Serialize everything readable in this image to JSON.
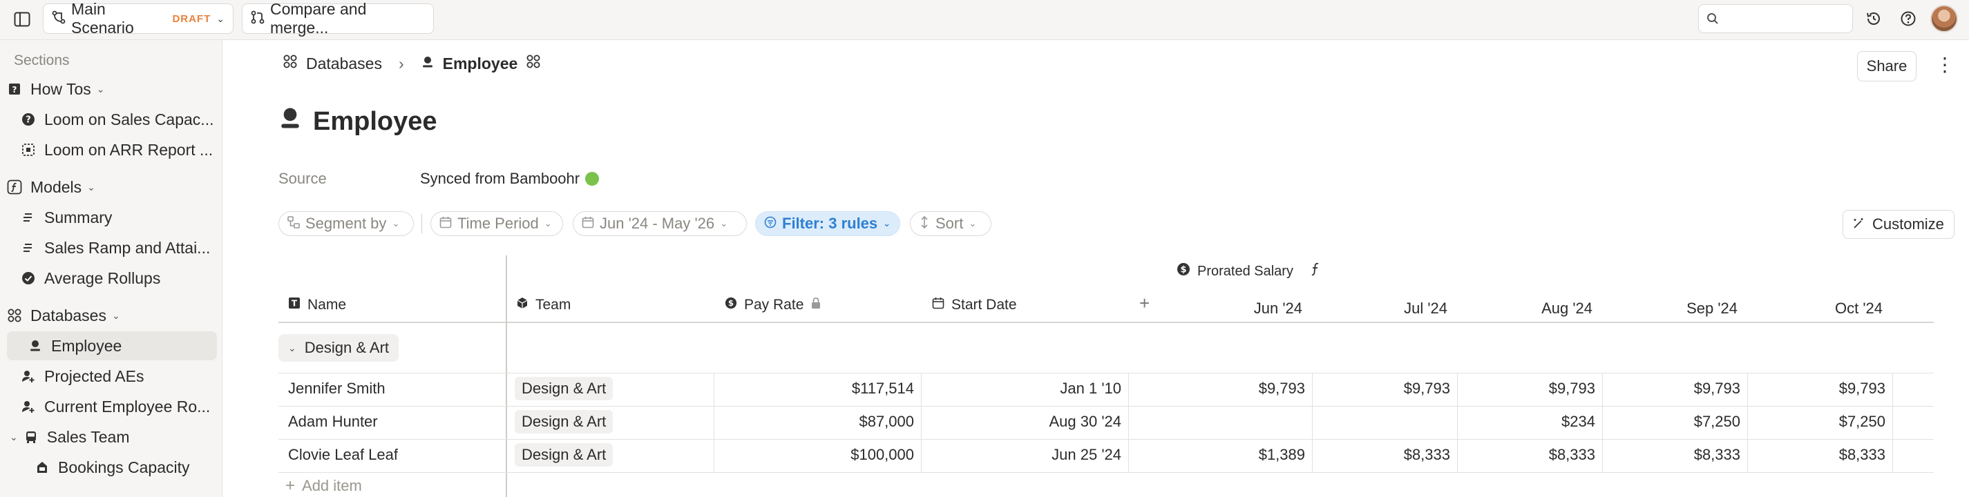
{
  "topbar": {
    "scenario_name": "Main Scenario",
    "scenario_badge": "DRAFT",
    "compare_label": "Compare and merge...",
    "search_placeholder": ""
  },
  "sidebar": {
    "section_label": "Sections",
    "how_tos": {
      "label": "How Tos",
      "items": [
        {
          "label": "Loom on Sales Capac..."
        },
        {
          "label": "Loom on ARR Report ..."
        }
      ]
    },
    "models": {
      "label": "Models",
      "items": [
        {
          "label": "Summary"
        },
        {
          "label": "Sales Ramp and Attai..."
        },
        {
          "label": "Average Rollups"
        }
      ]
    },
    "databases": {
      "label": "Databases",
      "items": [
        {
          "label": "Employee"
        },
        {
          "label": "Projected AEs"
        },
        {
          "label": "Current Employee Ro..."
        }
      ]
    },
    "sales_team": {
      "label": "Sales Team",
      "items": [
        {
          "label": "Bookings Capacity"
        }
      ]
    }
  },
  "breadcrumb": {
    "parent": "Databases",
    "current": "Employee"
  },
  "header": {
    "share_label": "Share",
    "more_label": "⋮"
  },
  "page": {
    "title": "Employee",
    "source_label": "Source",
    "source_value": "Synced from Bamboohr"
  },
  "toolbar": {
    "segment_by": "Segment by",
    "time_period": "Time Period",
    "date_range": "Jun '24 - May '26",
    "filter": "Filter: 3 rules",
    "sort": "Sort",
    "customize": "Customize"
  },
  "table": {
    "prorated_label": "Prorated Salary",
    "columns": {
      "name": "Name",
      "team": "Team",
      "pay_rate": "Pay Rate",
      "start_date": "Start Date"
    },
    "add_column": "+",
    "months": [
      "Jun '24",
      "Jul '24",
      "Aug '24",
      "Sep '24",
      "Oct '24"
    ],
    "group": "Design & Art",
    "rows": [
      {
        "name": "Jennifer Smith",
        "team": "Design & Art",
        "pay_rate": "$117,514",
        "start_date": "Jan 1 '10",
        "salaries": [
          "$9,793",
          "$9,793",
          "$9,793",
          "$9,793",
          "$9,793"
        ]
      },
      {
        "name": "Adam Hunter",
        "team": "Design & Art",
        "pay_rate": "$87,000",
        "start_date": "Aug 30 '24",
        "salaries": [
          "",
          "",
          "$234",
          "$7,250",
          "$7,250"
        ]
      },
      {
        "name": "Clovie Leaf Leaf",
        "team": "Design & Art",
        "pay_rate": "$100,000",
        "start_date": "Jun 25 '24",
        "salaries": [
          "$1,389",
          "$8,333",
          "$8,333",
          "$8,333",
          "$8,333"
        ]
      }
    ],
    "add_item": "Add item"
  }
}
